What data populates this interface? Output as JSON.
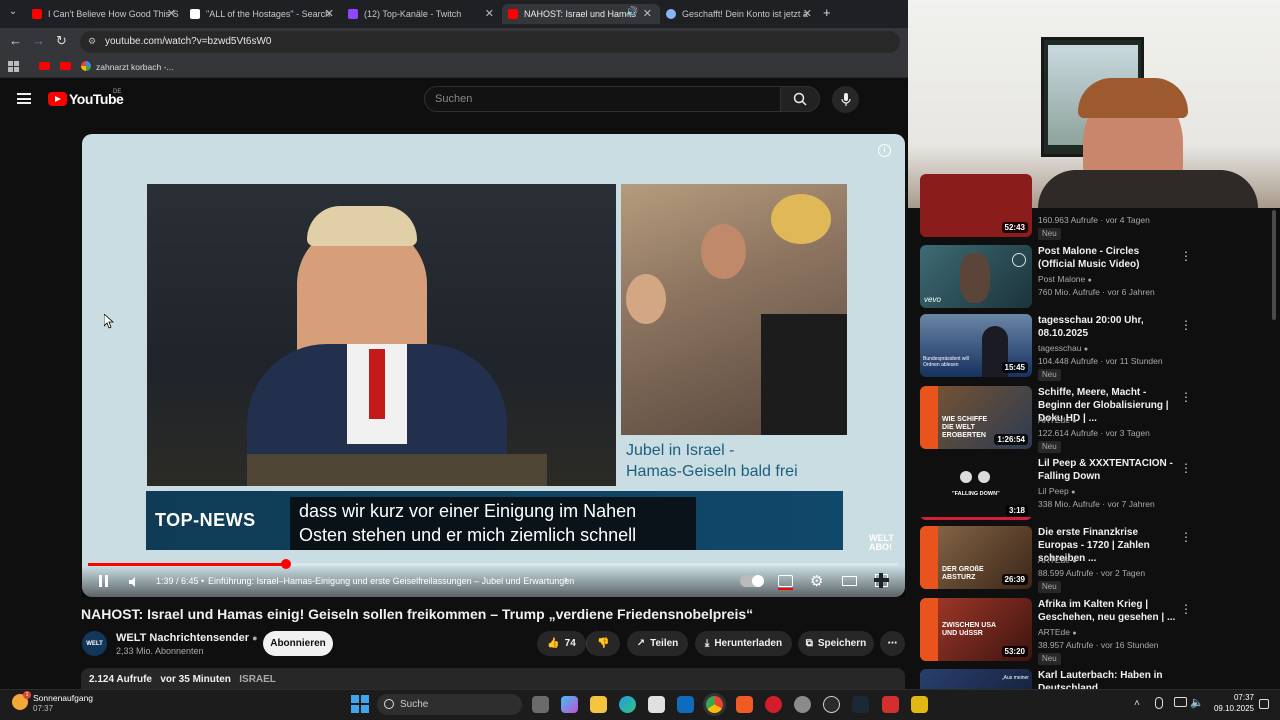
{
  "browser": {
    "tabs": [
      {
        "label": "I Can't Believe How Good This S",
        "color": "#ff0000"
      },
      {
        "label": "\"ALL of the Hostages\" - Search",
        "color": "#ffffff"
      },
      {
        "label": "(12) Top-Kanäle - Twitch",
        "color": "#9146ff"
      },
      {
        "label": "NAHOST: Israel und Hamas",
        "color": "#ff0000"
      },
      {
        "label": "Geschafft! Dein Konto ist jetzt a",
        "color": "#8ab4f8"
      }
    ],
    "url": "youtube.com/watch?v=bzwd5Vt6sW0",
    "bookmark": "zahnarzt korbach -..."
  },
  "youtube": {
    "logo": "YouTube",
    "region": "DE",
    "search_placeholder": "Suchen"
  },
  "player": {
    "caption": "Jubel in Israel -\nHamas-Geiseln bald frei",
    "banner": "TOP-NEWS",
    "subtitle_line1": "dass wir kurz vor einer Einigung im Nahen",
    "subtitle_line2": "Osten stehen und er mich ziemlich schnell",
    "watermark_top": "WELT",
    "watermark_bottom": "ABO!",
    "time": "1:39 / 6:45",
    "chapter": "Einführung: Israel–Hamas-Einigung und erste Geiselfreilassungen – Jubel und Erwartungen",
    "progress": 0.245
  },
  "video": {
    "title": "NAHOST: Israel und Hamas einig! Geiseln sollen freikommen – Trump „verdiene Friedensnobelpreis“",
    "channel": "WELT Nachrichtensender",
    "avatar_text": "WELT",
    "subscribers": "2,33 Mio. Abonnenten",
    "subscribe": "Abonnieren",
    "likes": "74",
    "share": "Teilen",
    "download": "Herunterladen",
    "save": "Speichern",
    "views": "2.124 Aufrufe",
    "age": "vor 35 Minuten",
    "tag": "ISRAEL"
  },
  "recommendations": [
    {
      "title": "",
      "channel": "",
      "meta": "160.963 Aufrufe · vor 4 Tagen",
      "duration": "52:43",
      "badge": "Neu",
      "color": "#8a1c1c"
    },
    {
      "title": "Post Malone - Circles (Official Music Video)",
      "channel": "Post Malone",
      "meta": "760 Mio. Aufrufe · vor 6 Jahren",
      "duration": "",
      "badge": "",
      "color": "#2e4f59"
    },
    {
      "title": "tagesschau 20:00 Uhr, 08.10.2025",
      "channel": "tagesschau",
      "meta": "104.448 Aufrufe · vor 11 Stunden",
      "duration": "15:45",
      "badge": "Neu",
      "color": "#1e3c6a"
    },
    {
      "title": "Schiffe, Meere, Macht - Beginn der Globalisierung | Doku HD | ...",
      "channel": "ARTEde",
      "meta": "122.614 Aufrufe · vor 3 Tagen",
      "duration": "1:26:54",
      "badge": "Neu",
      "color": "#5c3a1d"
    },
    {
      "title": "Lil Peep & XXXTENTACION - Falling Down",
      "channel": "Lil Peep",
      "meta": "338 Mio. Aufrufe · vor 7 Jahren",
      "duration": "3:18",
      "badge": "",
      "color": "#111111"
    },
    {
      "title": "Die erste Finanzkrise Europas - 1720 | Zahlen schreiben ...",
      "channel": "ARTEde",
      "meta": "88.599 Aufrufe · vor 2 Tagen",
      "duration": "26:39",
      "badge": "Neu",
      "color": "#5a3a24"
    },
    {
      "title": "Afrika im Kalten Krieg | Geschehen, neu gesehen | ...",
      "channel": "ARTEde",
      "meta": "38.957 Aufrufe · vor 16 Stunden",
      "duration": "53:20",
      "badge": "Neu",
      "color": "#7a2620"
    },
    {
      "title": "Karl Lauterbach: Haben in Deutschland...",
      "channel": "",
      "meta": "",
      "duration": "",
      "badge": "",
      "color": "#1d2f55"
    }
  ],
  "thumb_overlays": {
    "arte1": "WIE SCHIFFE DIE WELT EROBERTEN",
    "arte2": "DER GROßE ABSTURZ",
    "arte3": "ZWISCHEN USA UND UdSSR",
    "lilpeep": "\"FALLING DOWN\"",
    "tagesschau": "Bundespräsident will Ordnen ablesen",
    "karl": "„Aus meiner"
  },
  "taskbar": {
    "weather_title": "Sonnenaufgang",
    "weather_time": "07:37",
    "search": "Suche",
    "clock_time": "07:37",
    "clock_date": "09.10.2025"
  }
}
